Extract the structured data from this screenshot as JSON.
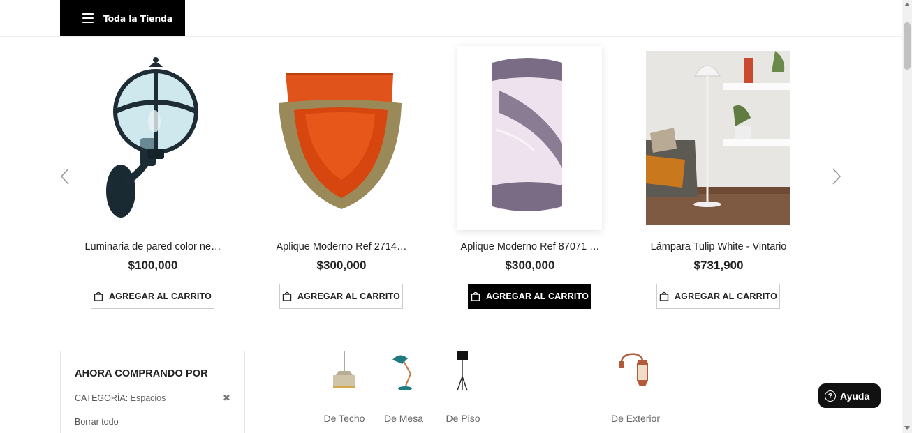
{
  "header": {
    "store_button_label": "Toda la Tienda"
  },
  "carousel": {
    "products": [
      {
        "name": "Luminaria de pared color ne…",
        "price": "$100,000",
        "button_label": "AGREGAR AL CARRITO",
        "button_active": false
      },
      {
        "name": "Aplique Moderno Ref 2714…",
        "price": "$300,000",
        "button_label": "AGREGAR AL CARRITO",
        "button_active": false
      },
      {
        "name": "Aplique Moderno Ref 87071 …",
        "price": "$300,000",
        "button_label": "AGREGAR AL CARRITO",
        "button_active": true
      },
      {
        "name": "Lámpara Tulip White - Vintario",
        "price": "$731,900",
        "button_label": "AGREGAR AL CARRITO",
        "button_active": false
      }
    ]
  },
  "filters": {
    "title": "AHORA COMPRANDO POR",
    "category_key": "CATEGORÍA:",
    "category_value": "Espacios",
    "remove_symbol": "✖",
    "clear_all": "Borrar todo"
  },
  "categories": [
    {
      "label": "De Techo",
      "icon": "pendant-lamp-icon"
    },
    {
      "label": "De Mesa",
      "icon": "desk-lamp-icon"
    },
    {
      "label": "De Piso",
      "icon": "floor-lamp-icon"
    },
    {
      "label": "De Exterior",
      "icon": "outdoor-lantern-icon"
    }
  ],
  "help": {
    "symbol": "?",
    "label": "Ayuda"
  },
  "colors": {
    "primary": "#000000",
    "text": "#222222",
    "muted": "#666666"
  }
}
